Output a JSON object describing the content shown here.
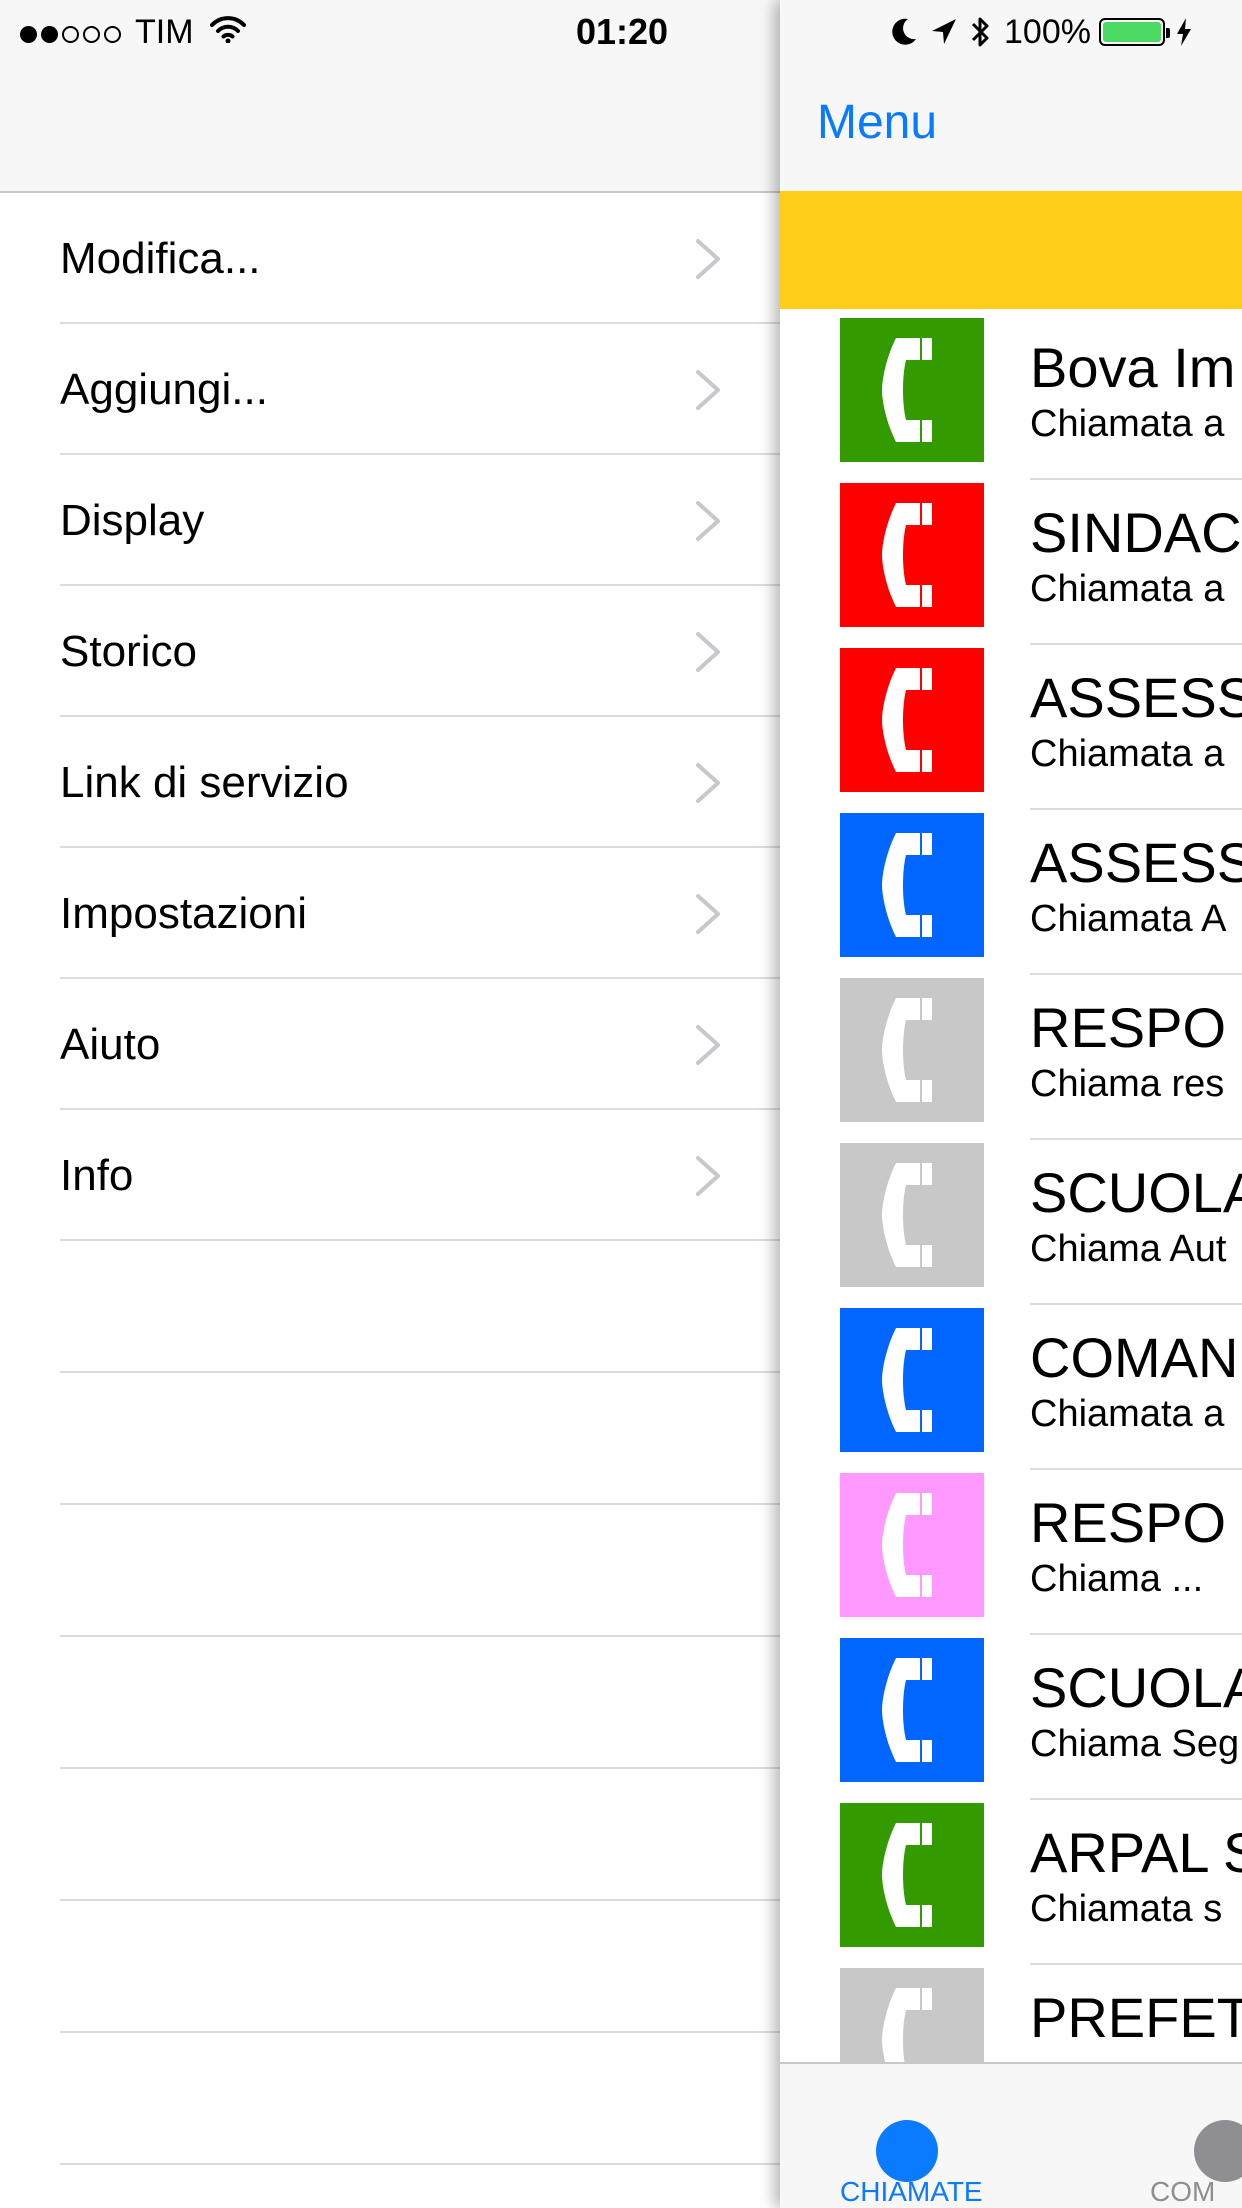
{
  "status_bar": {
    "carrier": "TIM",
    "time": "01:20",
    "battery_percent": "100%",
    "signal_bars_filled": 2,
    "signal_bars_total": 5
  },
  "menu": {
    "items": [
      {
        "label": "Modifica..."
      },
      {
        "label": "Aggiungi..."
      },
      {
        "label": "Display"
      },
      {
        "label": "Storico"
      },
      {
        "label": "Link di servizio"
      },
      {
        "label": "Impostazioni"
      },
      {
        "label": "Aiuto"
      },
      {
        "label": "Info"
      }
    ]
  },
  "main": {
    "nav_button": "Menu",
    "banner_color": "#fdcd1a",
    "accent_color": "#0a7aff",
    "contacts": [
      {
        "name": "Bova Im",
        "subtitle": "Chiamata a",
        "color": "#339a00"
      },
      {
        "name": "SINDAC",
        "subtitle": "Chiamata a",
        "color": "#ff0000"
      },
      {
        "name": "ASSESS",
        "subtitle": "Chiamata a",
        "color": "#ff0000"
      },
      {
        "name": "ASSESS",
        "subtitle": "Chiamata A",
        "color": "#0066ff"
      },
      {
        "name": "RESPO",
        "subtitle": "Chiama res",
        "color": "#c8c8c8"
      },
      {
        "name": "SCUOLA",
        "subtitle": "Chiama Aut",
        "color": "#c8c8c8"
      },
      {
        "name": "COMAN",
        "subtitle": "Chiamata a",
        "color": "#0066ff"
      },
      {
        "name": "RESPO",
        "subtitle": "Chiama ...",
        "color": "#ff99ff"
      },
      {
        "name": "SCUOLA",
        "subtitle": "Chiama Seg",
        "color": "#0066ff"
      },
      {
        "name": "ARPAL S",
        "subtitle": "Chiamata s",
        "color": "#339a00"
      },
      {
        "name": "PREFET",
        "subtitle": "",
        "color": "#c8c8c8"
      }
    ],
    "tabs": [
      {
        "label": "CHIAMATE",
        "color": "#0a7aff"
      },
      {
        "label": "COM",
        "color": "#8e8e93"
      }
    ]
  }
}
